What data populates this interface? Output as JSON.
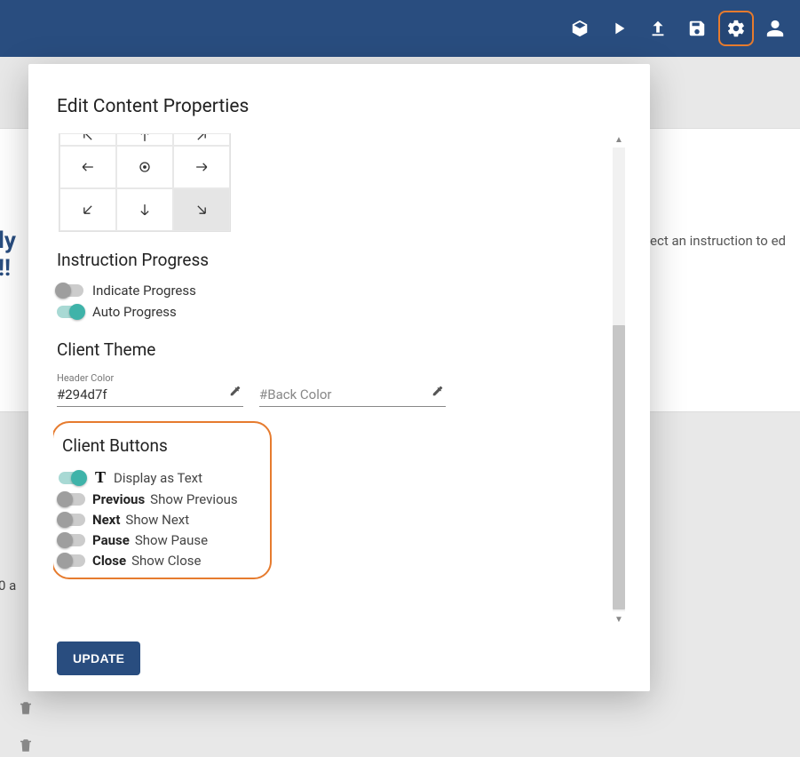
{
  "background": {
    "hint_text": "ect an instruction to ed",
    "left_stub_1": "ly",
    "left_stub_2": "!!",
    "bottom_stub": "0 a"
  },
  "modal": {
    "title": "Edit Content Properties",
    "sections": {
      "instruction_progress": {
        "title": "Instruction Progress",
        "toggles": [
          {
            "label": "Indicate Progress",
            "on": false
          },
          {
            "label": "Auto Progress",
            "on": true
          }
        ]
      },
      "client_theme": {
        "title": "Client Theme",
        "header_color": {
          "label": "Header Color",
          "value": "#294d7f"
        },
        "back_color": {
          "placeholder": "#Back Color"
        }
      },
      "client_buttons": {
        "title": "Client Buttons",
        "rows": [
          {
            "bold": "T",
            "label": "Display as Text",
            "icon": true,
            "on": true
          },
          {
            "bold": "Previous",
            "label": "Show Previous",
            "on": false
          },
          {
            "bold": "Next",
            "label": "Show Next",
            "on": false
          },
          {
            "bold": "Pause",
            "label": "Show Pause",
            "on": false
          },
          {
            "bold": "Close",
            "label": "Show Close",
            "on": false
          }
        ]
      }
    },
    "update_button": "UPDATE"
  }
}
